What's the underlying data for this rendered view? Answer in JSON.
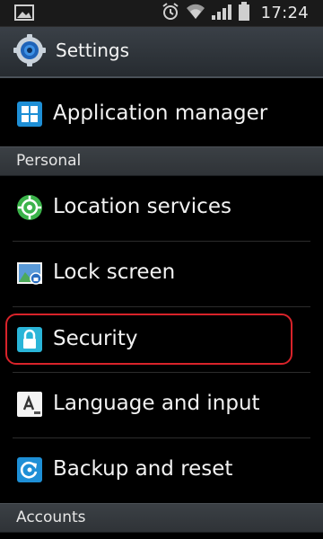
{
  "status_bar": {
    "time": "17:24"
  },
  "action_bar": {
    "title": "Settings"
  },
  "items": [
    {
      "label": "Application manager"
    },
    {
      "label": "Location services"
    },
    {
      "label": "Lock screen"
    },
    {
      "label": "Security"
    },
    {
      "label": "Language and input"
    },
    {
      "label": "Backup and reset"
    }
  ],
  "sections": [
    {
      "label": "Personal"
    },
    {
      "label": "Accounts"
    }
  ],
  "colors": {
    "highlight": "#d8232a",
    "app_icon": "#1e8fd6",
    "location_icon": "#3bb34a",
    "security_icon": "#2ab5d8"
  }
}
